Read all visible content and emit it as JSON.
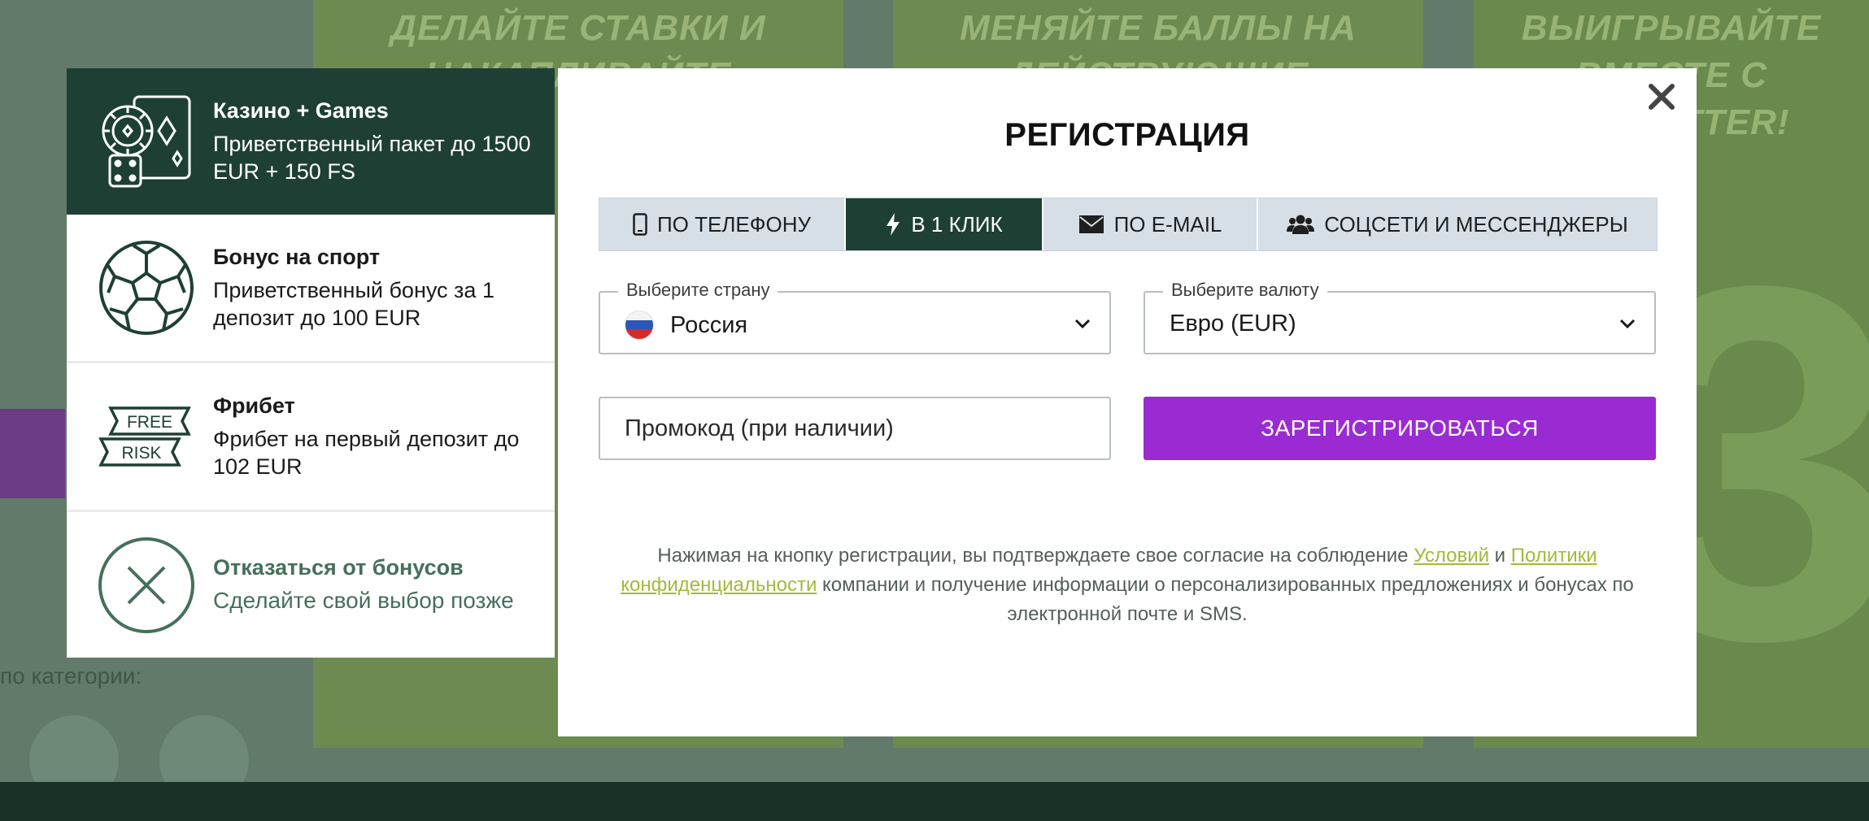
{
  "background": {
    "panels": [
      {
        "headline": "ДЕЛАЙТЕ СТАВКИ И НАКАПЛИВАЙТЕ"
      },
      {
        "headline": "МЕНЯЙТЕ БАЛЛЫ НА ДЕЙСТВУЮЩИЕ ПРОМОКОДЫ"
      },
      {
        "headline": "ВЫИГРЫВАЙТЕ ВМЕСТЕ С FUNBETTER!"
      }
    ],
    "category_text": "по категории:",
    "big_number": "3"
  },
  "bonuses": [
    {
      "title": "Казино + Games",
      "desc": "Приветственный пакет до 1500 EUR + 150 FS",
      "icon": "casino-chips-dice-icon"
    },
    {
      "title": "Бонус на спорт",
      "desc": "Приветственный бонус за 1 депозит до 100 EUR",
      "icon": "soccer-ball-icon"
    },
    {
      "title": "Фрибет",
      "desc": "Фрибет на первый депозит до 102 EUR",
      "icon": "free-risk-icon",
      "icon_text": [
        "FREE",
        "RISK"
      ]
    },
    {
      "title": "Отказаться от бонусов",
      "desc": "Сделайте свой выбор позже",
      "icon": "decline-x-icon"
    }
  ],
  "modal": {
    "title": "РЕГИСТРАЦИЯ",
    "close_icon": "close-icon",
    "tabs": [
      {
        "label": "ПО ТЕЛЕФОНУ",
        "icon": "mobile-phone-icon"
      },
      {
        "label": "В 1 КЛИК",
        "icon": "lightning-icon",
        "active": true
      },
      {
        "label": "ПО E-MAIL",
        "icon": "envelope-icon"
      },
      {
        "label": "СОЦСЕТИ И МЕССЕНДЖЕРЫ",
        "icon": "users-icon"
      }
    ],
    "country": {
      "label": "Выберите страну",
      "value": "Россия"
    },
    "currency": {
      "label": "Выберите валюту",
      "value": "Евро (EUR)"
    },
    "promo": {
      "placeholder": "Промокод (при наличии)"
    },
    "register_label": "ЗАРЕГИСТРИРОВАТЬСЯ",
    "consent": {
      "before": "Нажимая на кнопку регистрации, вы подтверждаете свое согласие на соблюдение ",
      "terms_link": "Условий",
      "and": " и ",
      "privacy_link": "Политики конфиденциальности",
      "after": " компании и получение информации о персонализированных предложениях и бонусах по электронной почте и SMS."
    }
  },
  "colors": {
    "dark_green": "#1e4034",
    "purple": "#9a2bd2",
    "link": "#a6b83a",
    "tab_bg": "#d6dfe6"
  }
}
